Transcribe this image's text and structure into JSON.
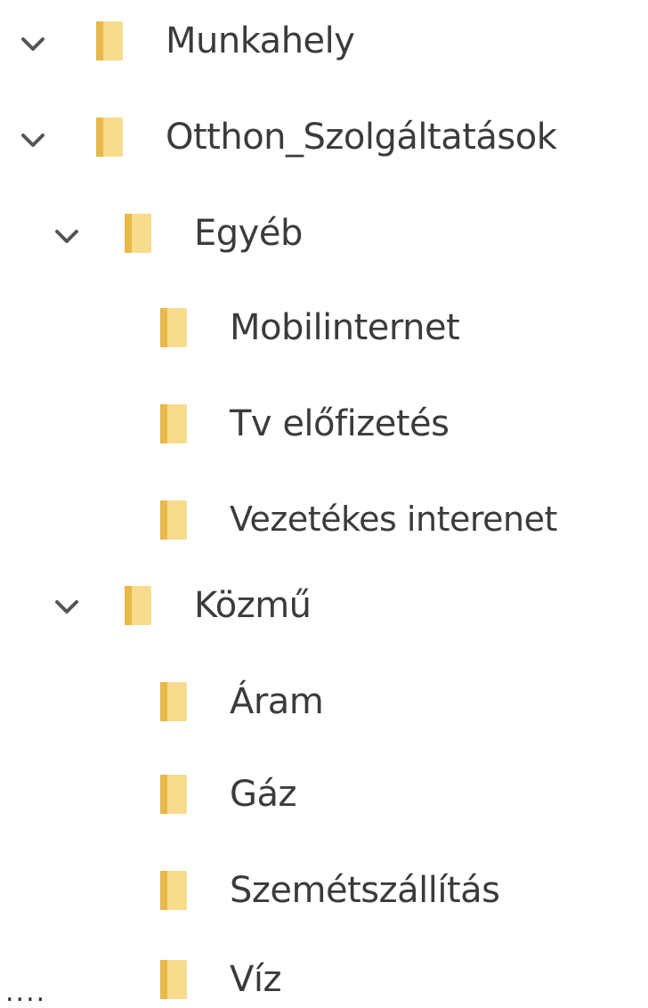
{
  "tree": {
    "nodes": [
      {
        "label": "Munkahely",
        "expanded": true
      },
      {
        "label": "Otthon_Szolgáltatások",
        "expanded": true
      },
      {
        "label": "Egyéb",
        "expanded": true
      },
      {
        "label": "Mobilinternet",
        "expanded": false
      },
      {
        "label": "Tv előfizetés",
        "expanded": false
      },
      {
        "label": "Vezetékes interenet",
        "expanded": false
      },
      {
        "label": "Közmű",
        "expanded": true
      },
      {
        "label": "Áram",
        "expanded": false
      },
      {
        "label": "Gáz",
        "expanded": false
      },
      {
        "label": "Szemétszállítás",
        "expanded": false
      },
      {
        "label": "Víz",
        "expanded": false
      }
    ],
    "ellipsis": "...."
  },
  "icons": {
    "expand": "chevron-down-icon",
    "folder": "folder-icon"
  },
  "colors": {
    "folder_light": "#f7dc8e",
    "folder_dark": "#e8b94a",
    "chevron": "#555555",
    "text": "#3b3b3b"
  }
}
